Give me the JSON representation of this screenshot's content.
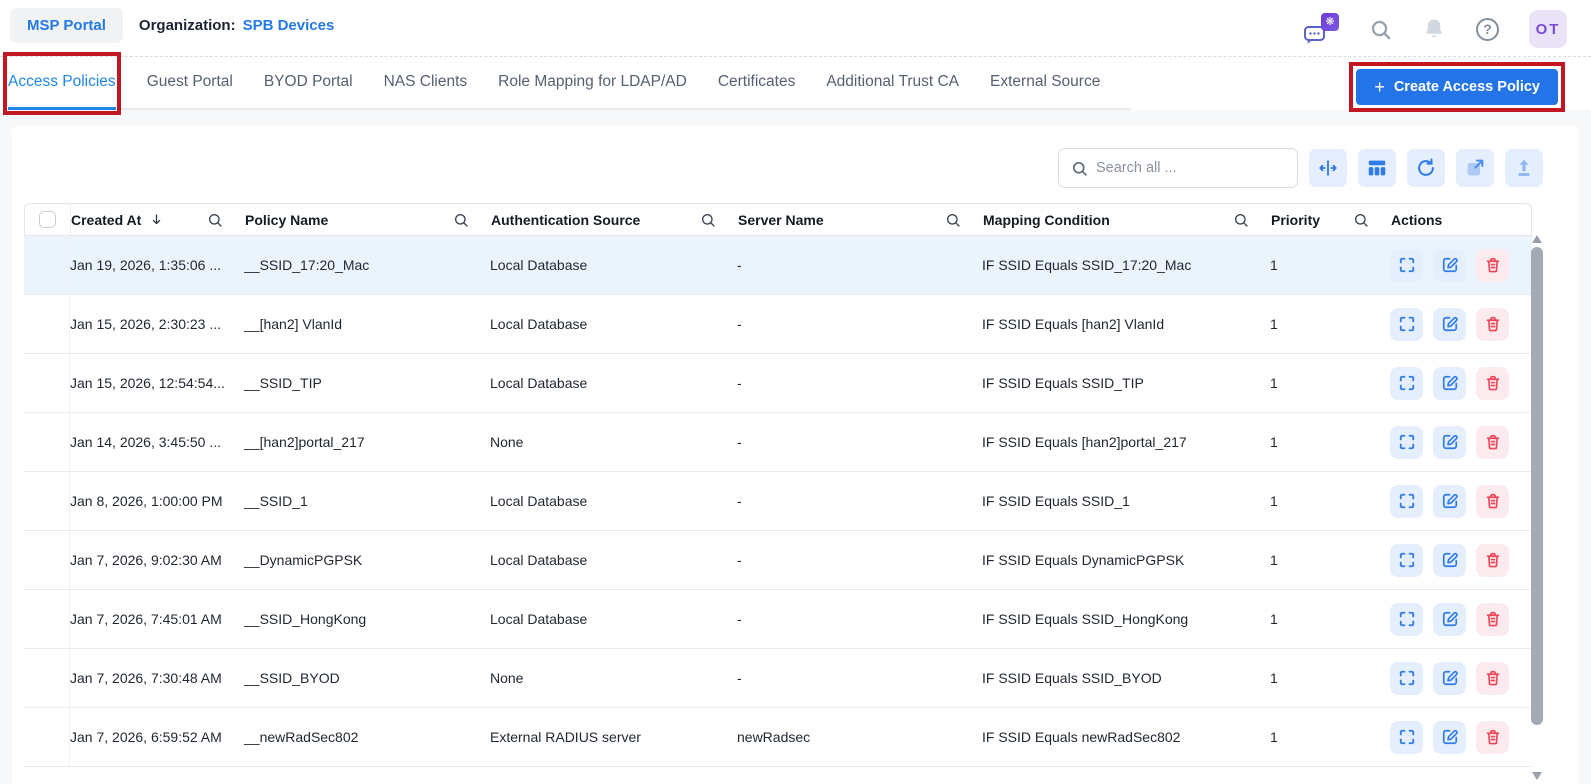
{
  "colors": {
    "accent_blue": "#2374e8",
    "active_tab_blue": "#1f86e8",
    "annotation_red": "#c01722",
    "delete_red": "#f04659",
    "row_highlight": "#ebf4fd",
    "icon_button_bg": "#e4eefd"
  },
  "header": {
    "portal_label": "MSP Portal",
    "org_label": "Organization:",
    "org_value": "SPB Devices",
    "avatar_initials": "OT"
  },
  "tabs": [
    {
      "label": "Access Policies",
      "active": true,
      "annotated": true
    },
    {
      "label": "Guest Portal"
    },
    {
      "label": "BYOD Portal"
    },
    {
      "label": "NAS Clients"
    },
    {
      "label": "Role Mapping for LDAP/AD"
    },
    {
      "label": "Certificates"
    },
    {
      "label": "Additional Trust CA"
    },
    {
      "label": "External Source"
    }
  ],
  "create_button": {
    "icon": "+",
    "label": "Create Access Policy"
  },
  "toolbar": {
    "search_placeholder": "Search all ..."
  },
  "table": {
    "columns": [
      {
        "label": "Created At"
      },
      {
        "label": "Policy Name"
      },
      {
        "label": "Authentication Source"
      },
      {
        "label": "Server Name"
      },
      {
        "label": "Mapping Condition"
      },
      {
        "label": "Priority"
      },
      {
        "label": "Actions"
      }
    ],
    "rows": [
      {
        "highlighted": true,
        "created_at": "Jan 19, 2026, 1:35:06 ...",
        "policy_name": "__SSID_17:20_Mac",
        "authentication_source": "Local Database",
        "server_name": "-",
        "mapping_condition": "IF SSID Equals SSID_17:20_Mac",
        "priority": "1"
      },
      {
        "created_at": "Jan 15, 2026, 2:30:23 ...",
        "policy_name": "__[han2] VlanId",
        "authentication_source": "Local Database",
        "server_name": "-",
        "mapping_condition": "IF SSID Equals [han2] VlanId",
        "priority": "1"
      },
      {
        "created_at": "Jan 15, 2026, 12:54:54...",
        "policy_name": "__SSID_TIP",
        "authentication_source": "Local Database",
        "server_name": "-",
        "mapping_condition": "IF SSID Equals SSID_TIP",
        "priority": "1"
      },
      {
        "created_at": "Jan 14, 2026, 3:45:50 ...",
        "policy_name": "__[han2]portal_217",
        "authentication_source": "None",
        "server_name": "-",
        "mapping_condition": "IF SSID Equals [han2]portal_217",
        "priority": "1"
      },
      {
        "created_at": "Jan 8, 2026, 1:00:00 PM",
        "policy_name": "__SSID_1",
        "authentication_source": "Local Database",
        "server_name": "-",
        "mapping_condition": "IF SSID Equals SSID_1",
        "priority": "1"
      },
      {
        "created_at": "Jan 7, 2026, 9:02:30 AM",
        "policy_name": "__DynamicPGPSK",
        "authentication_source": "Local Database",
        "server_name": "-",
        "mapping_condition": "IF SSID Equals DynamicPGPSK",
        "priority": "1"
      },
      {
        "created_at": "Jan 7, 2026, 7:45:01 AM",
        "policy_name": "__SSID_HongKong",
        "authentication_source": "Local Database",
        "server_name": "-",
        "mapping_condition": "IF SSID Equals SSID_HongKong",
        "priority": "1"
      },
      {
        "created_at": "Jan 7, 2026, 7:30:48 AM",
        "policy_name": "__SSID_BYOD",
        "authentication_source": "None",
        "server_name": "-",
        "mapping_condition": "IF SSID Equals SSID_BYOD",
        "priority": "1"
      },
      {
        "created_at": "Jan 7, 2026, 6:59:52 AM",
        "policy_name": "__newRadSec802",
        "authentication_source": "External RADIUS server",
        "server_name": "newRadsec",
        "mapping_condition": "IF SSID Equals newRadSec802",
        "priority": "1"
      }
    ]
  }
}
